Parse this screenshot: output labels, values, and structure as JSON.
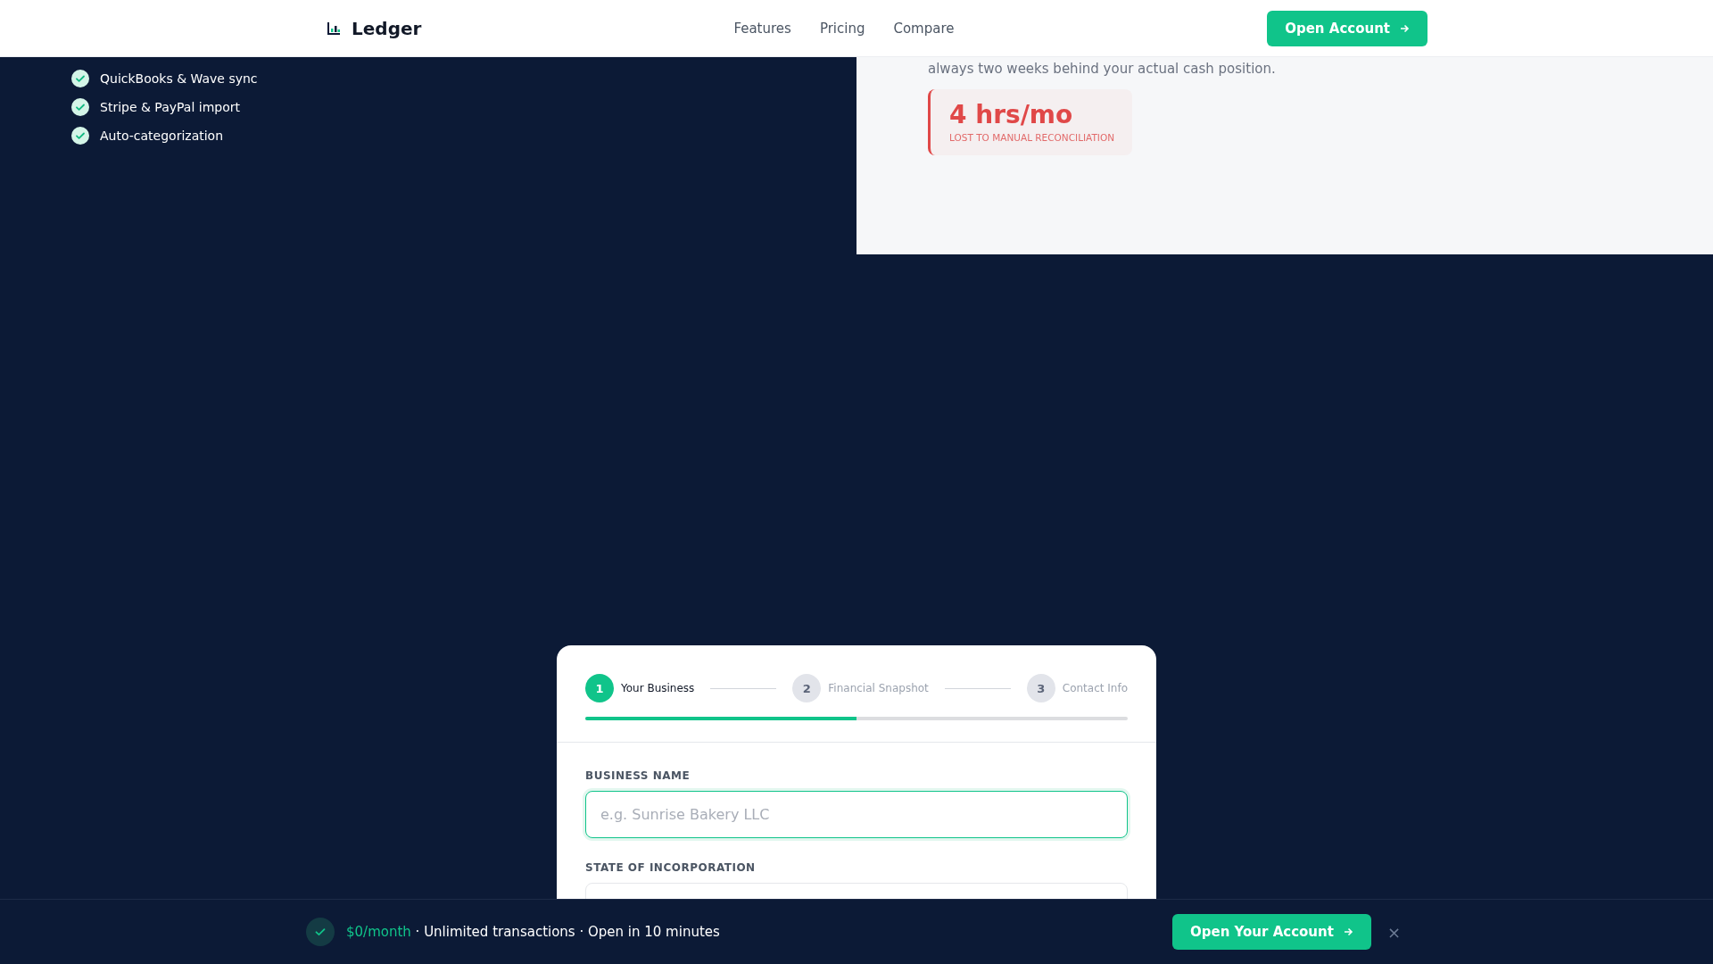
{
  "nav": {
    "brand": "Ledger",
    "links": [
      "Features",
      "Pricing",
      "Compare"
    ],
    "cta": "Open Account"
  },
  "features": [
    "QuickBooks & Wave sync",
    "Stripe & PayPal import",
    "Auto-categorization"
  ],
  "pain": {
    "text": "always two weeks behind your actual cash position.",
    "stat": "4 hrs/mo",
    "stat_label": "LOST TO MANUAL RECONCILIATION"
  },
  "form": {
    "steps": [
      {
        "number": "1",
        "label": "Your Business",
        "selected": true
      },
      {
        "number": "2",
        "label": "Financial Snapshot",
        "selected": false
      },
      {
        "number": "3",
        "label": "Contact Info",
        "selected": false
      }
    ],
    "progress": {
      "level": 0.5
    },
    "fields": [
      {
        "label": "BUSINESS NAME",
        "placeholder": "e.g. Sunrise Bakery LLC",
        "focused": true
      },
      {
        "label": "STATE OF INCORPORATION",
        "focused": false
      }
    ]
  },
  "sticky_bar": {
    "price": "$0/month",
    "details": " · Unlimited transactions · Open in 10 minutes",
    "cta": "Open Your Account",
    "close": "×"
  }
}
